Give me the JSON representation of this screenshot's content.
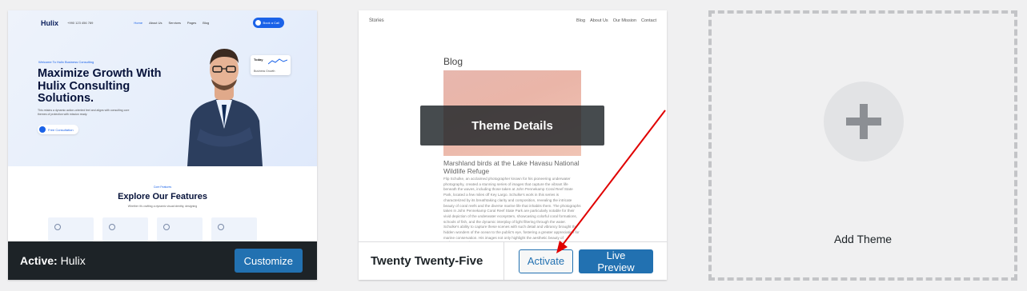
{
  "themes": [
    {
      "id": "hulix",
      "name": "Hulix",
      "active_prefix": "Active:",
      "customize_label": "Customize",
      "preview": {
        "logo": "Hulix",
        "phone": "+990 123 456 789",
        "menu": [
          "Home",
          "About Us",
          "Services",
          "Pages",
          "Blog"
        ],
        "cta": "Book a Call",
        "eyebrow": "Welcome To Hulix Business Consulting",
        "title": "Maximize Growth With Hulix Consulting Solutions.",
        "description": "This retains a dynamic action-oriented feel and aligns with consulting core themes of protection with mission ready.",
        "button": "Free Consultation",
        "badge_title": "Today",
        "badge_sub": "Business Growth",
        "features_eyebrow": "Core Features",
        "features_title": "Explore Our Features",
        "features_desc": "Whether it's crafting a dynamic visual identity, designing"
      }
    },
    {
      "id": "twentytwentyfive",
      "name": "Twenty Twenty-Five",
      "details_label": "Theme Details",
      "activate_label": "Activate",
      "live_preview_label": "Live Preview",
      "preview": {
        "site_title": "Stories",
        "nav": [
          "Blog",
          "About Us",
          "Our Mission",
          "Contact"
        ],
        "heading": "Blog",
        "post_title": "Marshland birds at the Lake Havasu National Wildlife Refuge",
        "post_body": "Flip Schulke, an acclaimed photographer known for his pioneering underwater photography, created a stunning series of images that capture the vibrant life beneath the waves, including those taken at John Pennekamp Coral Reef State Park, located a few miles off Key Largo. Schulke's work in this series is characterized by its breathtaking clarity and composition, revealing the intricate beauty of coral reefs and the diverse marine life that inhabits them. The photographs taken in John Pennekamp Coral Reef State Park are particularly notable for their vivid depiction of the underwater ecosystem, showcasing colorful coral formations, schools of fish, and the dynamic interplay of light filtering through the water. Schulke's ability to capture these scenes with such detail and vibrancy brought the hidden wonders of the ocean to the public's eye, fostering a greater appreciation for marine conservation. His images not only highlight the aesthetic beauty of underwater environments"
      }
    }
  ],
  "add_theme": {
    "label": "Add Theme",
    "icon": "plus-icon"
  },
  "colors": {
    "primary": "#2271b1",
    "active_footer": "#1d2327",
    "arrow": "#e00000"
  }
}
